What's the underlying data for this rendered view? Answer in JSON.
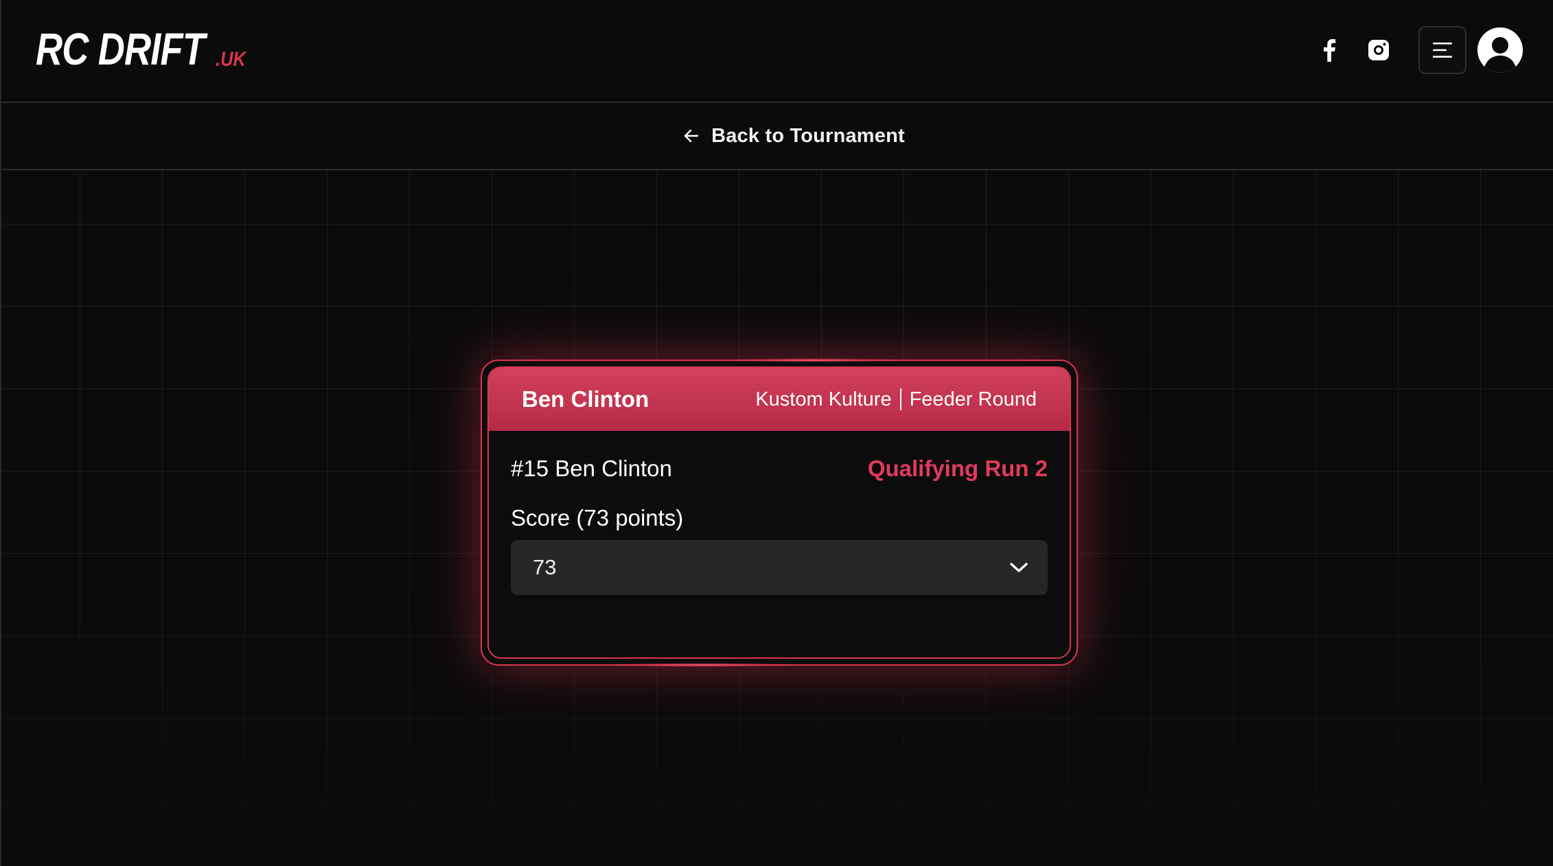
{
  "brand": {
    "name": "RC DRIFT",
    "suffix": ".UK",
    "accent_color": "#d9354f"
  },
  "header": {
    "social": [
      {
        "name": "facebook",
        "icon": "facebook-icon"
      },
      {
        "name": "instagram",
        "icon": "instagram-icon"
      }
    ],
    "menu_icon": "menu-icon",
    "avatar_icon": "user-avatar-icon"
  },
  "subbar": {
    "back_label": "Back to Tournament",
    "back_icon": "arrow-left-icon"
  },
  "card": {
    "header_name": "Ben Clinton",
    "team": "Kustom Kulture",
    "round": "Feeder Round",
    "driver_line": "#15 Ben Clinton",
    "run_label": "Qualifying Run 2",
    "score_label": "Score (73 points)",
    "score_select": {
      "selected": "73",
      "icon": "chevron-down-icon"
    }
  },
  "colors": {
    "background": "#0b0b0c",
    "card_header": "#c4334f",
    "run_text": "#e23a5c",
    "select_bg": "#262628"
  }
}
